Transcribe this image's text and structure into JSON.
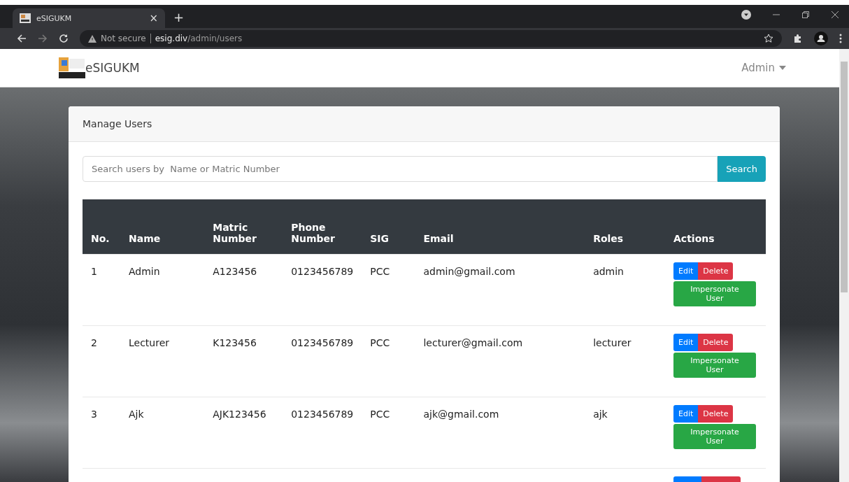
{
  "browser": {
    "tab_title": "eSIGUKM",
    "tab_close": "×",
    "new_tab": "+",
    "security": "Not secure",
    "url_host": "esig.div",
    "url_path": "/admin/users"
  },
  "navbar": {
    "brand": "eSIGUKM",
    "user_menu": "Admin"
  },
  "card": {
    "title": "Manage Users",
    "search": {
      "placeholder": "Search users by  Name or Matric Number",
      "button": "Search"
    }
  },
  "table": {
    "columns": [
      "No.",
      "Name",
      "Matric Number",
      "Phone Number",
      "SIG",
      "Email",
      "Roles",
      "Actions"
    ],
    "rows": [
      {
        "no": "1",
        "name": "Admin",
        "matric": "A123456",
        "phone": "0123456789",
        "sig": "PCC",
        "email": "admin@gmail.com",
        "role": "admin",
        "actions": [
          "Edit",
          "Delete",
          "Impersonate User"
        ]
      },
      {
        "no": "2",
        "name": "Lecturer",
        "matric": "K123456",
        "phone": "0123456789",
        "sig": "PCC",
        "email": "lecturer@gmail.com",
        "role": "lecturer",
        "actions": [
          "Edit",
          "Delete",
          "Impersonate User"
        ]
      },
      {
        "no": "3",
        "name": "Ajk",
        "matric": "AJK123456",
        "phone": "0123456789",
        "sig": "PCC",
        "email": "ajk@gmail.com",
        "role": "ajk",
        "actions": [
          "Edit",
          "Delete",
          "Impersonate User"
        ]
      }
    ]
  }
}
